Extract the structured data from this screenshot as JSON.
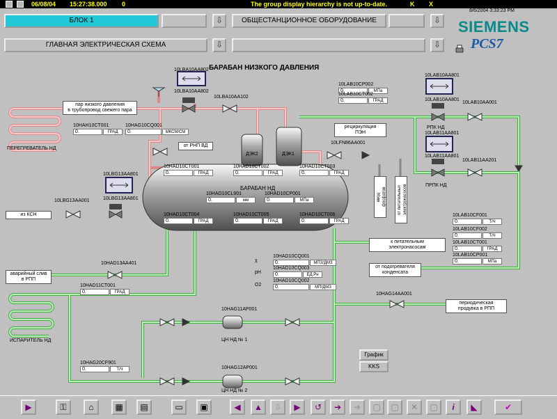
{
  "topbar": {
    "date": "06/08/04",
    "time": "15:27:38.000",
    "counter": "0",
    "message": "The group display hierarchy is not up-to-date.",
    "k": "K",
    "x": "X"
  },
  "header": {
    "datetime": "8/6/2004 3:33:23 PM",
    "btn_block": "БЛОК 1",
    "btn_station": "ОБЩЕСТАНЦИОННОЕ ОБОРУДОВАНИЕ",
    "btn_main_scheme": "ГЛАВНАЯ ЭЛЕКТРИЧЕСКАЯ СХЕМА",
    "brand": "SIEMENS",
    "product": "PCS7"
  },
  "main": {
    "title": "БАРАБАН НИЗКОГО ДАВЛЕНИЯ",
    "drum_label": "БАРАБАН НД",
    "dek2": "ДЭК2",
    "dek1": "ДЭК1",
    "superheater": "ПЕРЕГРЕВАТЕЛЬ НД",
    "evaporator": "ИСПАРИТЕЛЬ НД",
    "pump1": "ЦН НД № 1",
    "pump2": "ЦН НД № 2",
    "rpk": "РПК НД",
    "prpk": "ПРПК НД",
    "tags": {
      "steam_to_pipe": "пар низкого давления\nв трубопровод свежего пара",
      "from_ksn": "из КСН",
      "emergency_drain": "аварийный слив\nв РПП",
      "from_rnp": "от РНП ВД",
      "recirc_pen": "рециркуляция\nПЭН",
      "phosphates": "ввод\nфосфатов",
      "from_feed_pumps": "от питательных\nэлектронасосов",
      "to_feed_pumps": "к питательным\nэлектронасосам",
      "from_condensate_heater": "от подогревателя\nконденсата",
      "periodic_purge": "периодическая\nпродувка в РПП"
    },
    "instruments": [
      {
        "id": "10LAB10CP002",
        "value": "0.",
        "unit": "МПа"
      },
      {
        "id": "10LAB10CT002",
        "value": "0.",
        "unit": "ГРАД"
      },
      {
        "id": "10HAH10CT001",
        "value": "0.",
        "unit": "ГРАД"
      },
      {
        "id": "10HAG10CQ001",
        "value": "0.",
        "unit": "МКСМ/СМ"
      },
      {
        "id": "10HAD10CT001",
        "value": "0.",
        "unit": "ГРАД"
      },
      {
        "id": "10HAD10CT002",
        "value": "0.",
        "unit": "ГРАД"
      },
      {
        "id": "10HAD10CT003",
        "value": "0.",
        "unit": "ГРАД"
      },
      {
        "id": "10HAD10CL901",
        "value": "0.",
        "unit": "мм"
      },
      {
        "id": "10HAD10CP001",
        "value": "0.",
        "unit": "МПа"
      },
      {
        "id": "10HAD10CT004",
        "value": "0.",
        "unit": "ГРАД"
      },
      {
        "id": "10HAD10CT005",
        "value": "0.",
        "unit": "ГРАД"
      },
      {
        "id": "10HAD10CT006",
        "value": "0.",
        "unit": "ГРАД"
      },
      {
        "id": "10LAB10CF001",
        "value": "0.",
        "unit": "Т/Ч"
      },
      {
        "id": "10LAB10CF002",
        "value": "0.",
        "unit": "Т/Ч"
      },
      {
        "id": "10LAB10CT001",
        "value": "0.",
        "unit": "ГРАД"
      },
      {
        "id": "10LAB10CP001",
        "value": "0.",
        "unit": "МПа"
      },
      {
        "id": "10HAD10CQ001",
        "value": "0.",
        "unit": "МПЗ/ДМЗ"
      },
      {
        "id": "10HAD10CQ003",
        "value": "0.",
        "unit": "ЕД.Рн"
      },
      {
        "id": "10HAD10CQ002",
        "value": "0.",
        "unit": "МП/ДМЗ"
      },
      {
        "id": "10HAD11CT001",
        "value": "0.",
        "unit": "ГРАД"
      },
      {
        "id": "10HAG20CF901",
        "value": "0.",
        "unit": "Т/Ч"
      }
    ],
    "valves": {
      "v1": "10LBA10AA802",
      "v2": "10LBA10AA102",
      "v3": "10LAB10AA801",
      "v4": "10LAB10AA001",
      "v5": "10LAB11AA801",
      "v6": "10LAB11AA201",
      "v7": "10LFN86AA001",
      "v8": "10LBG13AA801",
      "v9": "10LBG13AA001",
      "v10": "10HAD13AA401",
      "v11": "10HAG11AP001",
      "v12": "10HAG12AP001",
      "v13": "10HAG14AA001"
    },
    "quality": {
      "chi": "χ",
      "ph": "pH",
      "o2": "O2",
      "na": "Na"
    },
    "btn_graph": "График",
    "btn_kks": "KKS"
  },
  "colors": {
    "steam_pipe": "#e8a0a0",
    "water_pipe": "#7fd87f",
    "selected": "#22c8d8",
    "topbar_text": "#ffff00"
  }
}
